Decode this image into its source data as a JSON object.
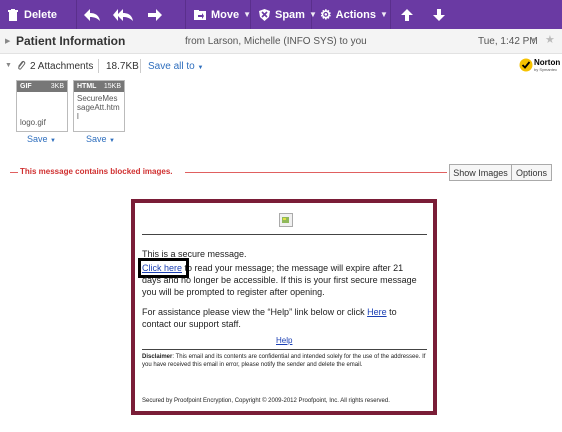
{
  "toolbar": {
    "delete": "Delete",
    "move": "Move",
    "spam": "Spam",
    "actions": "Actions"
  },
  "message": {
    "subject": "Patient Information",
    "from": "from Larson, Michelle (INFO SYS) to you",
    "date": "Tue, 1:42 PM"
  },
  "attachments": {
    "count_label": "2 Attachments",
    "size": "18.7KB",
    "save_all": "Save all to",
    "files": [
      {
        "type": "GIF",
        "size": "3KB",
        "name": "logo.gif",
        "save": "Save"
      },
      {
        "type": "HTML",
        "size": "15KB",
        "name": "SecureMessageAtt.html",
        "save": "Save"
      }
    ]
  },
  "security_badge": {
    "brand": "Norton",
    "sub": "by Symantec"
  },
  "blocked": {
    "text": "This message contains blocked images.",
    "show_images": "Show Images",
    "options": "Options"
  },
  "body": {
    "line1": "This is a secure message.",
    "click_here": "Click here",
    "line2_rest": " to read your message; the message will expire after 21",
    "line3": "days and no longer be accessible. If this is your first secure message",
    "line4": "you will be prompted to register after opening.",
    "assist1": "For assistance please view the “Help” link below or click ",
    "here": "Here",
    "assist1_end": " to",
    "assist2": "contact our support staff.",
    "help": "Help",
    "disclaimer_label": "Disclaimer",
    "disclaimer_text": ": This email and its contents are confidential and intended solely for the use of the addressee. If you have received this email in error, please notify the sender and delete the email.",
    "footer": "Secured by Proofpoint Encryption, Copyright © 2009-2012 Proofpoint, Inc. All rights reserved."
  },
  "colors": {
    "toolbar": "#6a3aa3",
    "frame": "#7a1d37",
    "link": "#1a3fb3",
    "blocked": "#d03030"
  }
}
